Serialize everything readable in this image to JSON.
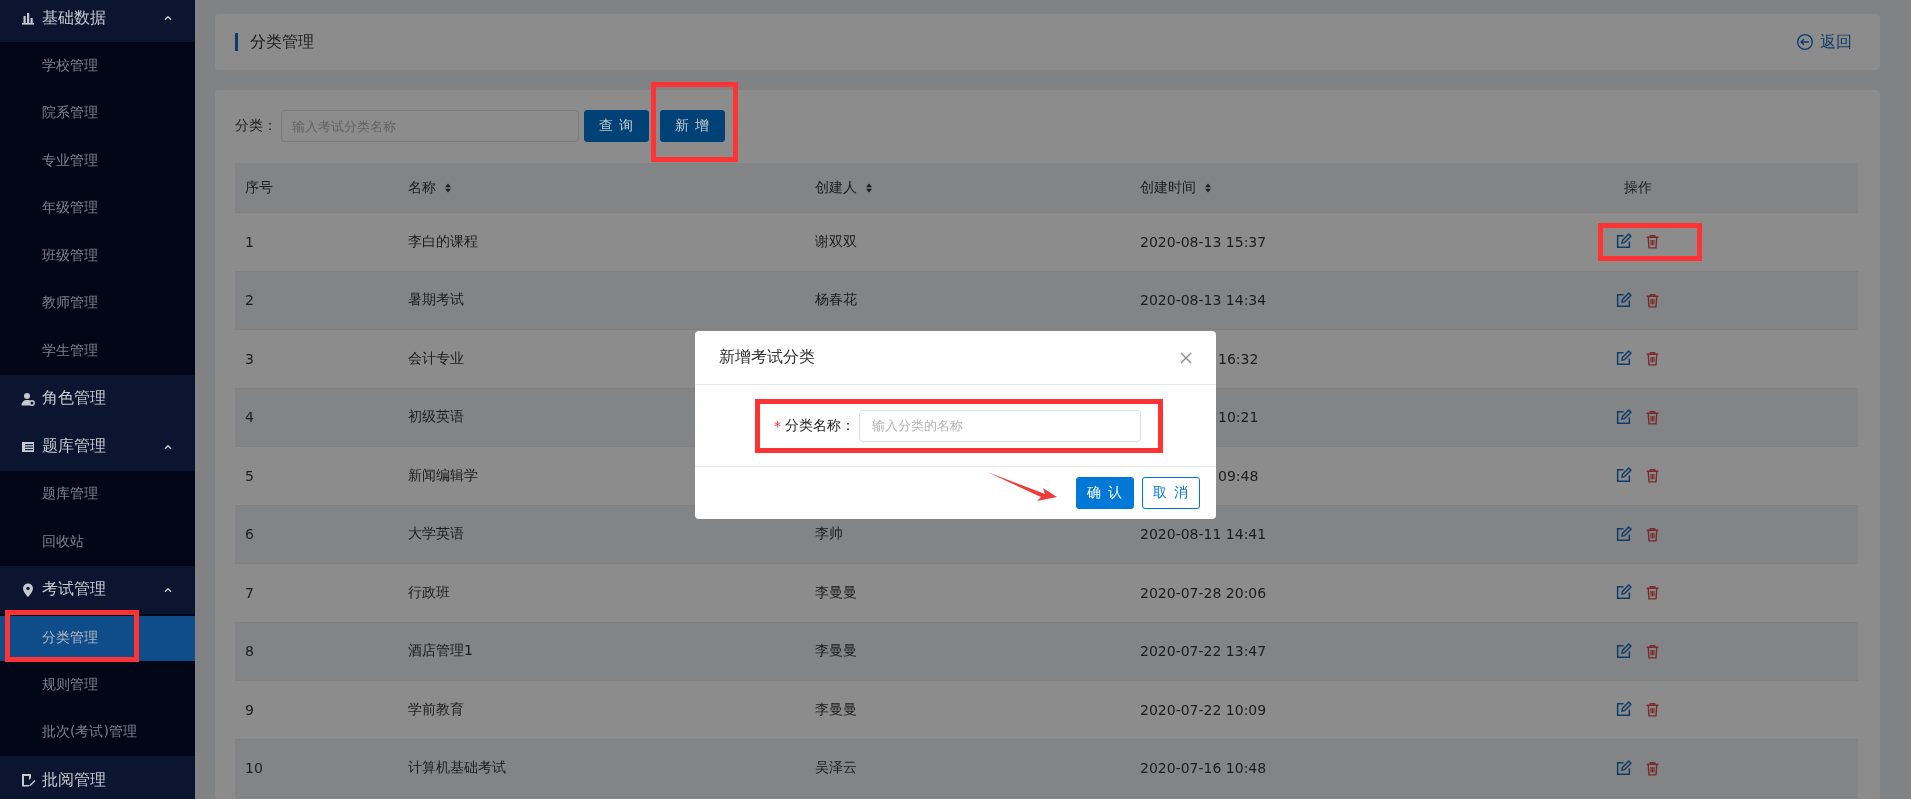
{
  "sidebar": {
    "groups": [
      {
        "label": "基础数据",
        "expanded": true,
        "items": [
          {
            "label": "学校管理",
            "selected": false
          },
          {
            "label": "院系管理",
            "selected": false
          },
          {
            "label": "专业管理",
            "selected": false
          },
          {
            "label": "年级管理",
            "selected": false
          },
          {
            "label": "班级管理",
            "selected": false
          },
          {
            "label": "教师管理",
            "selected": false
          },
          {
            "label": "学生管理",
            "selected": false
          }
        ]
      },
      {
        "label": "角色管理"
      },
      {
        "label": "题库管理",
        "expanded": true,
        "items": [
          {
            "label": "题库管理",
            "selected": false
          },
          {
            "label": "回收站",
            "selected": false
          }
        ]
      },
      {
        "label": "考试管理",
        "expanded": true,
        "items": [
          {
            "label": "分类管理",
            "selected": true,
            "annotated": true
          },
          {
            "label": "规则管理",
            "selected": false
          },
          {
            "label": "批次(考试)管理",
            "selected": false
          }
        ]
      },
      {
        "label": "批阅管理"
      }
    ]
  },
  "page_header": {
    "title": "分类管理",
    "back_link": "返回"
  },
  "filter": {
    "label": "分类：",
    "placeholder": "输入考试分类名称",
    "search_button": "查 询",
    "add_button": "新 增",
    "add_annotated": true
  },
  "table": {
    "columns": [
      {
        "label": "序号",
        "sortable": false
      },
      {
        "label": "名称",
        "sortable": true
      },
      {
        "label": "创建人",
        "sortable": true
      },
      {
        "label": "创建时间",
        "sortable": true
      },
      {
        "label": "操作",
        "sortable": false
      }
    ],
    "rows": [
      {
        "index": "1",
        "name": "李白的课程",
        "creator": "谢双双",
        "created": "2020-08-13 15:37",
        "annotated": true
      },
      {
        "index": "2",
        "name": "暑期考试",
        "creator": "杨春花",
        "created": "2020-08-13 14:34"
      },
      {
        "index": "3",
        "name": "会计专业",
        "created": "16:32",
        "covered": true
      },
      {
        "index": "4",
        "name": "初级英语",
        "created": "10:21",
        "covered": true
      },
      {
        "index": "5",
        "name": "新闻编辑学",
        "created": "09:48",
        "covered": true
      },
      {
        "index": "6",
        "name": "大学英语",
        "creator": "李帅",
        "created": "2020-08-11 14:41"
      },
      {
        "index": "7",
        "name": "行政班",
        "creator": "李曼曼",
        "created": "2020-07-28 20:06"
      },
      {
        "index": "8",
        "name": "酒店管理1",
        "creator": "李曼曼",
        "created": "2020-07-22 13:47"
      },
      {
        "index": "9",
        "name": "学前教育",
        "creator": "李曼曼",
        "created": "2020-07-22 10:09"
      },
      {
        "index": "10",
        "name": "计算机基础考试",
        "creator": "吴泽云",
        "created": "2020-07-16 10:48"
      }
    ]
  },
  "dialog": {
    "title": "新增考试分类",
    "field": {
      "required_mark": "*",
      "label": "分类名称：",
      "placeholder": "输入分类的名称",
      "annotated": true
    },
    "buttons": [
      {
        "label": "确 认",
        "kind": "primary"
      },
      {
        "label": "取 消",
        "kind": "secondary"
      }
    ]
  }
}
